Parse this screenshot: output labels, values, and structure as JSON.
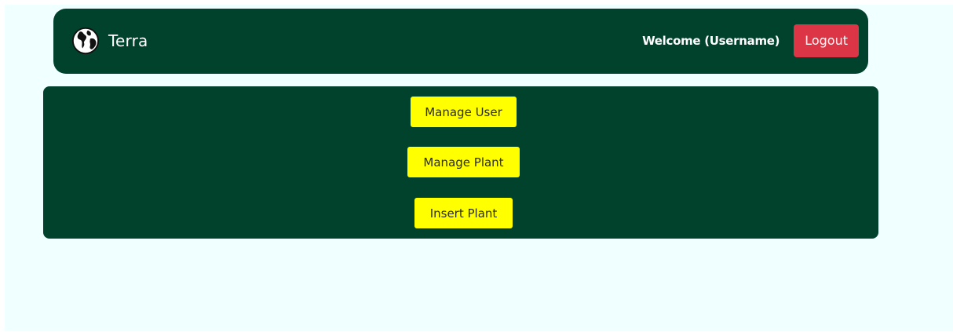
{
  "navbar": {
    "brand_icon": "globe-icon",
    "brand_name": "Terra",
    "welcome_text": "Welcome (Username)",
    "logout_label": "Logout"
  },
  "menu": {
    "items": [
      {
        "label": "Manage User"
      },
      {
        "label": "Manage Plant"
      },
      {
        "label": "Insert Plant"
      }
    ]
  },
  "colors": {
    "page_background": "#f0ffff",
    "panel_green": "#00422c",
    "button_yellow": "#ffff00",
    "logout_red": "#dc3545"
  }
}
